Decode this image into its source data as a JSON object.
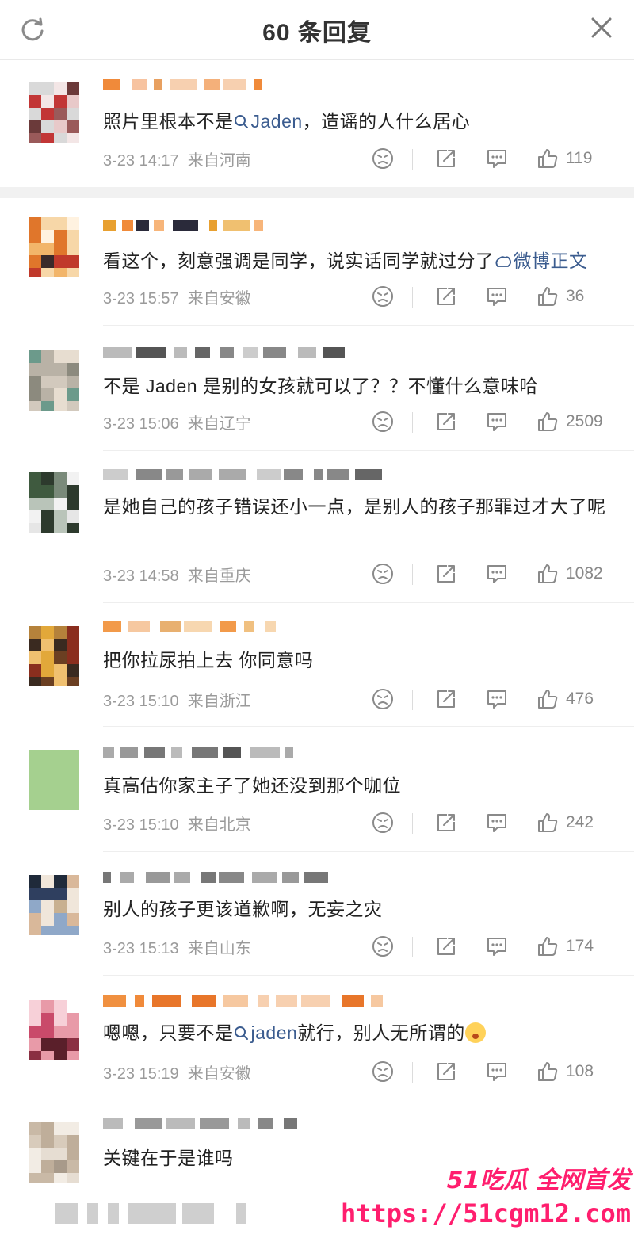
{
  "header": {
    "title": "60 条回复",
    "refresh_icon": "refresh-icon",
    "close_icon": "close-icon"
  },
  "comments": [
    {
      "segments": [
        {
          "t": "照片里根本不是",
          "m": false
        },
        {
          "t": "Jaden",
          "m": true
        },
        {
          "t": "，造谣的人什么居心",
          "m": false
        }
      ],
      "meta": "3-23 14:17  来自河南",
      "likes": "119"
    },
    {
      "segments": [
        {
          "t": "看这个，刻意强调是同学，说实话同学就过分了",
          "m": false
        },
        {
          "t": "微博正文",
          "m": true
        }
      ],
      "meta": "3-23 15:57  来自安徽",
      "likes": "36"
    },
    {
      "segments": [
        {
          "t": "不是 Jaden 是别的女孩就可以了？？不懂什么意味哈",
          "m": false
        }
      ],
      "meta": "3-23 15:06  来自辽宁",
      "likes": "2509"
    },
    {
      "segments": [
        {
          "t": "是她自己的孩子错误还小一点，是别人的孩子那罪过才大了呢",
          "m": false
        }
      ],
      "meta": "3-23 14:58  来自重庆",
      "likes": "1082"
    },
    {
      "segments": [
        {
          "t": "把你拉尿拍上去 你同意吗",
          "m": false
        }
      ],
      "meta": "3-23 15:10  来自浙江",
      "likes": "476"
    },
    {
      "segments": [
        {
          "t": "真高估你家主子了她还没到那个咖位",
          "m": false
        }
      ],
      "meta": "3-23 15:10  来自北京",
      "likes": "242"
    },
    {
      "segments": [
        {
          "t": "别人的孩子更该道歉啊，无妄之灾",
          "m": false
        }
      ],
      "meta": "3-23 15:13  来自山东",
      "likes": "174"
    },
    {
      "segments": [
        {
          "t": "嗯嗯，只要不是",
          "m": false
        },
        {
          "t": "jaden",
          "m": true
        },
        {
          "t": "就行，别人无所谓的",
          "m": false
        }
      ],
      "meta": "3-23 15:19  来自安徽",
      "likes": "108"
    },
    {
      "segments": [
        {
          "t": "关键在于是谁吗",
          "m": false
        }
      ],
      "meta": "",
      "likes": ""
    }
  ],
  "watermark": {
    "top": "51吃瓜 全网首发",
    "url": "https://51cgm12.com"
  },
  "colors": {
    "mention": "#3b5c8f",
    "meta": "#9a9a9a",
    "watermark": "#ff1e6e"
  }
}
